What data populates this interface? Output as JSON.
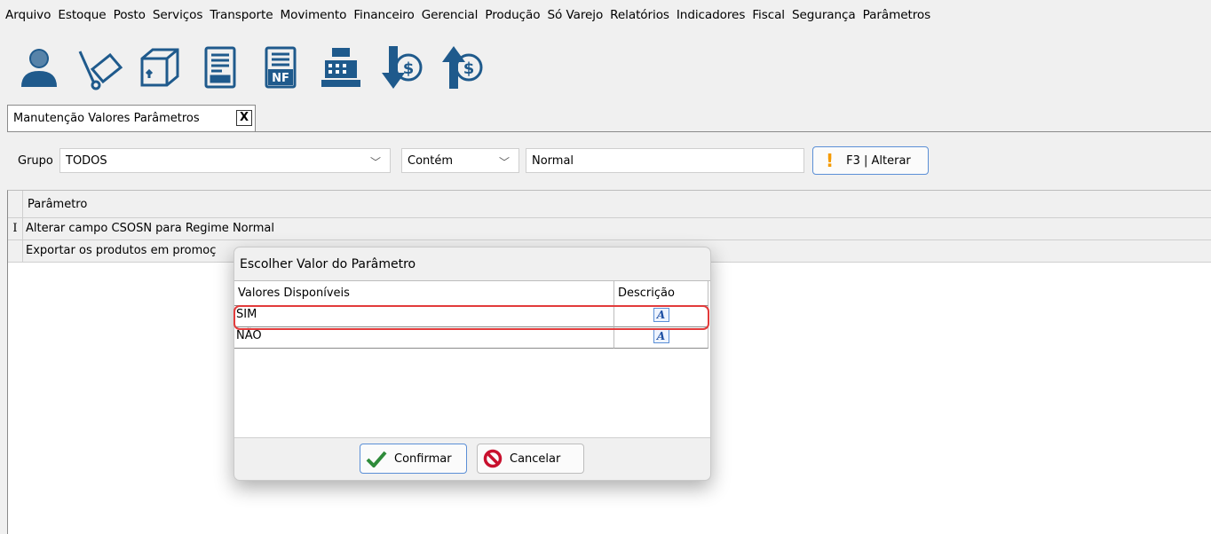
{
  "menu": {
    "items": [
      "Arquivo",
      "Estoque",
      "Posto",
      "Serviços",
      "Transporte",
      "Movimento",
      "Financeiro",
      "Gerencial",
      "Produção",
      "Só Varejo",
      "Relatórios",
      "Indicadores",
      "Fiscal",
      "Segurança",
      "Parâmetros"
    ]
  },
  "toolbar": {
    "icons": [
      "user-icon",
      "hand-truck-icon",
      "box-icon",
      "document-icon",
      "nf-document-icon",
      "cash-register-icon",
      "money-down-icon",
      "money-up-icon"
    ],
    "nf_text": "NF"
  },
  "tab": {
    "label": "Manutenção Valores Parâmetros",
    "close": "X"
  },
  "filters": {
    "grupo_label": "Grupo",
    "grupo_value": "TODOS",
    "condition_value": "Contém",
    "search_value": "Normal",
    "alterar_button": "F3 | Alterar"
  },
  "grid": {
    "header": "Parâmetro",
    "rows": [
      {
        "indicator": "I",
        "text": "Alterar campo CSOSN para Regime Normal"
      },
      {
        "indicator": "",
        "text": "Exportar os produtos em promoç"
      }
    ]
  },
  "dialog": {
    "title": "Escolher Valor do Parâmetro",
    "col_values": "Valores Disponíveis",
    "col_desc": "Descrição",
    "rows": [
      {
        "value": "SIM",
        "desc_icon": "A"
      },
      {
        "value": "NÃO",
        "desc_icon": "A"
      }
    ],
    "confirm": "Confirmar",
    "cancel": "Cancelar"
  },
  "colors": {
    "highlight": "#e23b3b",
    "accent": "#5b8fd6",
    "warning": "#f59a00"
  }
}
